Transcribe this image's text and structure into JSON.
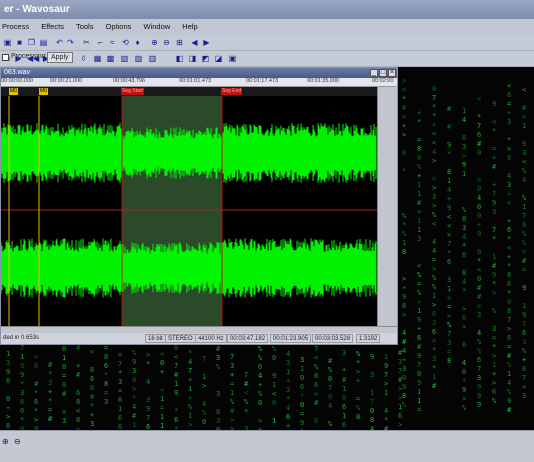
{
  "title": "er - Wavosaur",
  "menu": [
    "Process",
    "Effects",
    "Tools",
    "Options",
    "Window",
    "Help"
  ],
  "toolbar": {
    "filter_checkbox": "Processing",
    "apply_button": "Apply"
  },
  "wave_window": {
    "title": "063.wav",
    "ruler": [
      "00:00:00.000",
      "00:00:21.000",
      "00:00:43.796",
      "00:01:01.473",
      "00:01:17.473",
      "00:01:35.000",
      "00:02:00"
    ],
    "markers": [
      {
        "label": "M0",
        "color": "#e0c000"
      },
      {
        "label": "M0",
        "color": "#e0c000"
      },
      {
        "label": "Seg Start",
        "color": "#c01010"
      },
      {
        "label": "Seg End",
        "color": "#c01010"
      }
    ],
    "status": [
      "ded in 0.653s",
      "16 bit",
      "STEREO",
      "44100 Hz",
      "00:03:47.182",
      "00:01:23.905",
      "00:03:03.528",
      "1:3192"
    ]
  },
  "colors": {
    "wave": "#00ff00",
    "selection": "#2a4a2a",
    "matrix": "#1fbf3a",
    "titlebar": "#7f8dac"
  }
}
